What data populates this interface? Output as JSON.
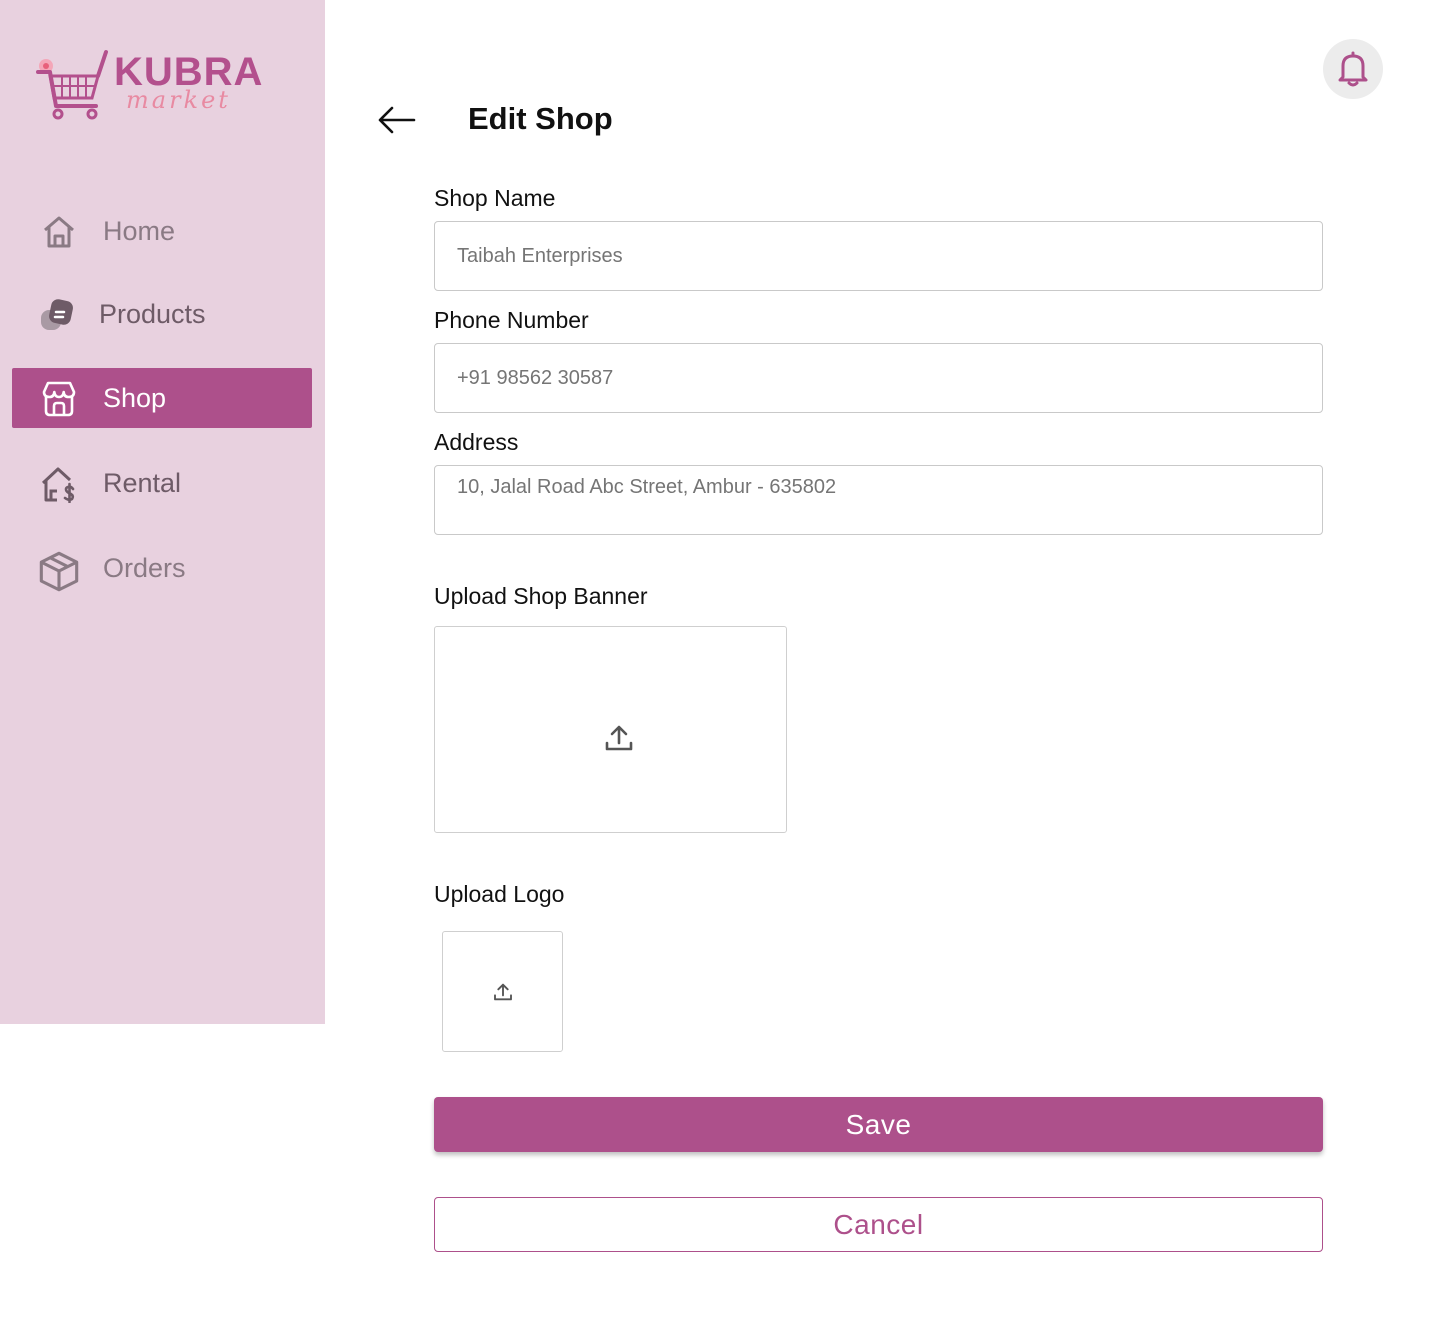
{
  "brand": {
    "name": "KUBRA",
    "tagline": "market",
    "accent": "#ad508b"
  },
  "sidebar": {
    "items": [
      {
        "label": "Home",
        "icon": "home-icon",
        "active": false
      },
      {
        "label": "Products",
        "icon": "products-icon",
        "active": false
      },
      {
        "label": "Shop",
        "icon": "shop-icon",
        "active": true
      },
      {
        "label": "Rental",
        "icon": "rental-icon",
        "active": false
      },
      {
        "label": "Orders",
        "icon": "orders-icon",
        "active": false
      }
    ]
  },
  "header": {
    "title": "Edit Shop",
    "back_icon": "arrow-left-icon",
    "notification_icon": "bell-icon"
  },
  "form": {
    "shop_name": {
      "label": "Shop Name",
      "placeholder": "Taibah Enterprises"
    },
    "phone": {
      "label": "Phone Number",
      "placeholder": "+91 98562 30587"
    },
    "address": {
      "label": "Address",
      "placeholder": "10, Jalal Road Abc Street, Ambur - 635802"
    },
    "banner": {
      "label": "Upload Shop Banner",
      "icon": "upload-icon"
    },
    "logo": {
      "label": "Upload Logo",
      "icon": "upload-icon"
    },
    "save_label": "Save",
    "cancel_label": "Cancel"
  }
}
